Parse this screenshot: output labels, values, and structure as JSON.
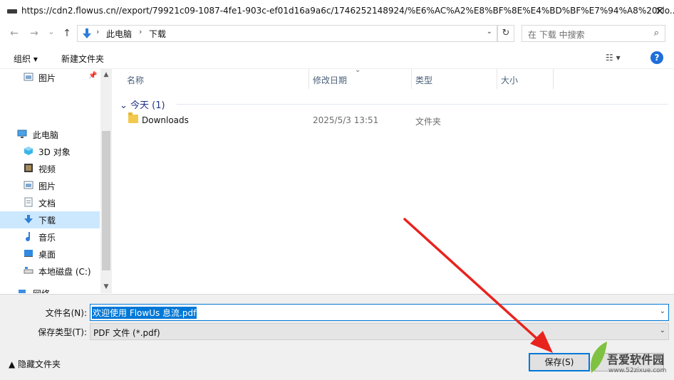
{
  "window": {
    "title": "https://cdn2.flowus.cn//export/79921c09-1087-4fe1-903c-ef01d16a9a6c/1746252148924/%E6%AC%A2%E8%BF%8E%E4%BD%BF%E7%94%A8%20Flo...",
    "close": "✕"
  },
  "nav": {
    "back": "←",
    "forward": "→",
    "dropdown": "⌄",
    "up": "↑",
    "refresh": "↻"
  },
  "address": {
    "segments": [
      "此电脑",
      "下载"
    ],
    "separator": "›"
  },
  "search": {
    "placeholder": "在 下载 中搜索",
    "icon": "⌕"
  },
  "toolbar": {
    "organize": "组织 ▾",
    "new_folder": "新建文件夹",
    "view": "☷ ▾",
    "help": "?"
  },
  "sidebar": {
    "items": [
      {
        "label": "图片",
        "pinned": "📌"
      },
      {
        "label": "此电脑"
      },
      {
        "label": "3D 对象"
      },
      {
        "label": "视频"
      },
      {
        "label": "图片"
      },
      {
        "label": "文档"
      },
      {
        "label": "下载"
      },
      {
        "label": "音乐"
      },
      {
        "label": "桌面"
      },
      {
        "label": "本地磁盘 (C:)"
      },
      {
        "label": "网络"
      }
    ]
  },
  "list": {
    "columns": [
      "名称",
      "修改日期",
      "类型",
      "大小"
    ],
    "sort_indicator": "⌄",
    "group": "⌄ 今天 (1)",
    "rows": [
      {
        "name": "Downloads",
        "date": "2025/5/3 13:51",
        "type": "文件夹"
      }
    ]
  },
  "form": {
    "filename_label": "文件名(N):",
    "filename_value": "欢迎使用 FlowUs 息流.pdf",
    "filetype_label": "保存类型(T):",
    "filetype_value": "PDF 文件 (*.pdf)",
    "dropdown": "⌄"
  },
  "footer": {
    "hide_folders": "▲  隐藏文件夹",
    "save": "保存(S)"
  },
  "watermark": {
    "text": "吾爱软件园",
    "url": "www.52zixue.com"
  },
  "colors": {
    "accent": "#0078d7",
    "selection": "#cce8ff",
    "arrow": "#e8231e",
    "group": "#1e3287"
  }
}
